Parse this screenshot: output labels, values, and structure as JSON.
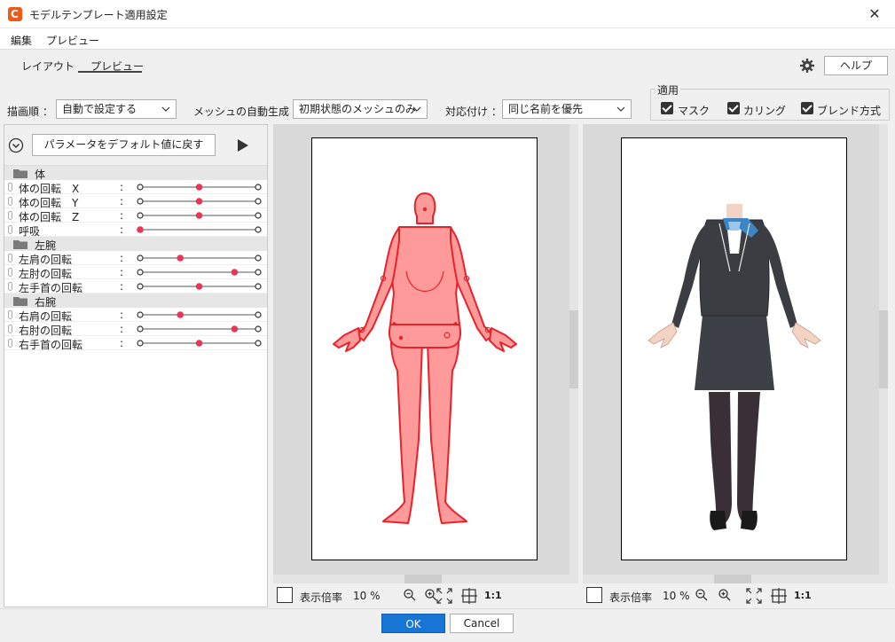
{
  "window": {
    "title": "モデルテンプレート適用設定",
    "close_glyph": "✕"
  },
  "menu": {
    "items": [
      "編集",
      "プレビュー"
    ]
  },
  "tabs": [
    {
      "label": "レイアウト"
    },
    {
      "label": "プレビュー"
    }
  ],
  "help_label": "ヘルプ",
  "options": {
    "draw_order_label": "描画順 ：",
    "draw_order_value": "自動で設定する",
    "mesh_label": "メッシュの自動生成 ：",
    "mesh_value": "初期状態のメッシュのみ",
    "match_label": "対応付け ：",
    "match_value": "同じ名前を優先"
  },
  "apply": {
    "title": "適用",
    "items": [
      {
        "label": "マスク",
        "checked": true
      },
      {
        "label": "カリング",
        "checked": true
      },
      {
        "label": "ブレンド方式",
        "checked": true
      }
    ]
  },
  "params": {
    "reset_label": "パラメータをデフォルト値に戻す",
    "colon": ":",
    "groups": [
      {
        "name": "体",
        "items": [
          {
            "name": "体の回転　X",
            "value": 0.5
          },
          {
            "name": "体の回転　Y",
            "value": 0.5
          },
          {
            "name": "体の回転　Z",
            "value": 0.5
          },
          {
            "name": "呼吸",
            "value": 0.0
          }
        ]
      },
      {
        "name": "左腕",
        "items": [
          {
            "name": "左肩の回転",
            "value": 0.34
          },
          {
            "name": "左肘の回転",
            "value": 0.8
          },
          {
            "name": "左手首の回転",
            "value": 0.5
          }
        ]
      },
      {
        "name": "右腕",
        "items": [
          {
            "name": "右肩の回転",
            "value": 0.34
          },
          {
            "name": "右肘の回転",
            "value": 0.8
          },
          {
            "name": "右手首の回転",
            "value": 0.5
          }
        ]
      }
    ]
  },
  "viewports": [
    {
      "zoom_label": "表示倍率",
      "zoom_value": "10 %",
      "ratio": "1:1"
    },
    {
      "zoom_label": "表示倍率",
      "zoom_value": "10 %",
      "ratio": "1:1"
    }
  ],
  "buttons": {
    "ok": "OK",
    "cancel": "Cancel"
  },
  "colors": {
    "accent": "#1874d5",
    "slider_knob": "#e8365a",
    "template_fill": "#ff9a9a",
    "template_stroke": "#e8222a",
    "suit": "#3b3d42"
  }
}
